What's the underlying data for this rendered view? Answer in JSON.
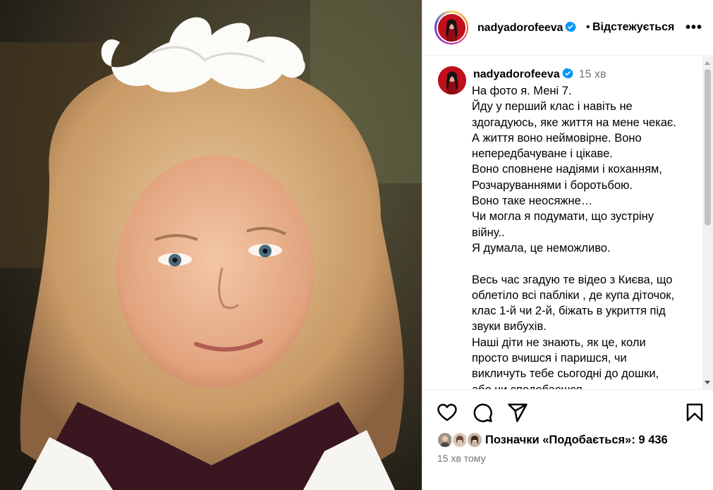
{
  "post": {
    "username": "nadyadorofeeva",
    "follow_label": "Відстежується",
    "separator": "•",
    "more_label": "•••"
  },
  "caption": {
    "username": "nadyadorofeeva",
    "time": "15 хв",
    "lines": [
      "На фото я. Мені 7.",
      "Йду у перший клас і навіть не",
      "здогадуюсь, яке життя на мене чекає.",
      "А життя воно неймовірне. Воно",
      "непередбачуване і цікаве.",
      "Воно сповнене надіями і коханням,",
      "Розчаруваннями і боротьбою.",
      "Воно таке неосяжне…",
      "Чи могла я подумати, що зустріну",
      "війну..",
      "Я думала, це неможливо.",
      "",
      "Весь час згадую те відео з Києва, що",
      "облетіло всі пабліки , де купа діточок,",
      "клас 1-й чи 2-й, біжать в укриття під",
      "звуки вибухів.",
      "Наші діти не знають, як це, коли",
      "просто вчишся і паришся, чи",
      "викличуть тебе сьогодні до дошки,",
      "або чи сподобаєшся..."
    ]
  },
  "likes": {
    "text": "Позначки «Подобається»: 9 436"
  },
  "footer": {
    "time_ago": "15 хв тому"
  },
  "icons": {
    "like": "heart-icon",
    "comment": "comment-icon",
    "share": "send-icon",
    "save": "bookmark-icon",
    "verified": "verified-badge-icon"
  },
  "colors": {
    "verified": "#0095f6",
    "muted": "#737373",
    "border": "#dbdbdb"
  }
}
